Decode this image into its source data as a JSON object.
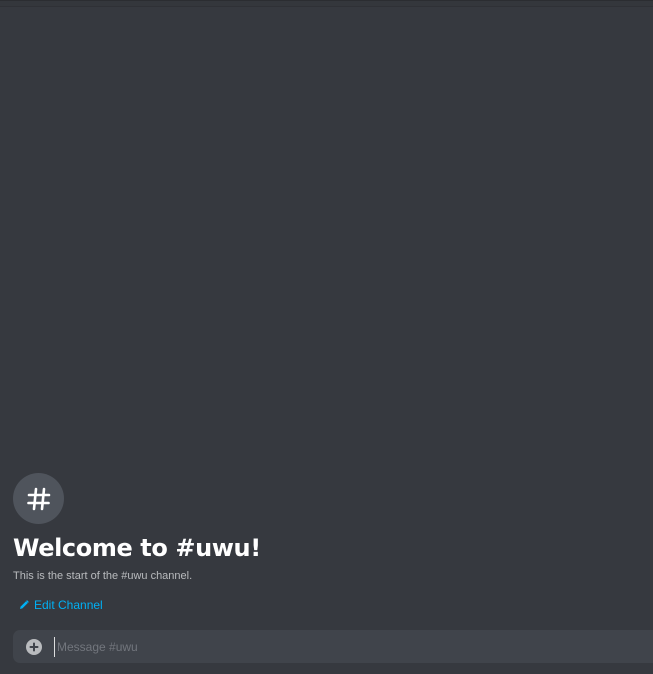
{
  "channel": {
    "badge_symbol": "#",
    "welcome_title": "Welcome to #uwu!",
    "welcome_subtitle": "This is the start of the #uwu channel.",
    "edit_label": "Edit Channel"
  },
  "composer": {
    "placeholder": "Message #uwu",
    "value": ""
  },
  "icons": {
    "badge": "hashtag-icon",
    "edit": "pencil-icon",
    "attach": "plus-circle-icon"
  },
  "colors": {
    "background": "#36393f",
    "badge": "#4f545c",
    "link": "#00b0f4",
    "composer": "#40444b",
    "title": "#ffffff",
    "subtitle": "#b9bbbe"
  }
}
